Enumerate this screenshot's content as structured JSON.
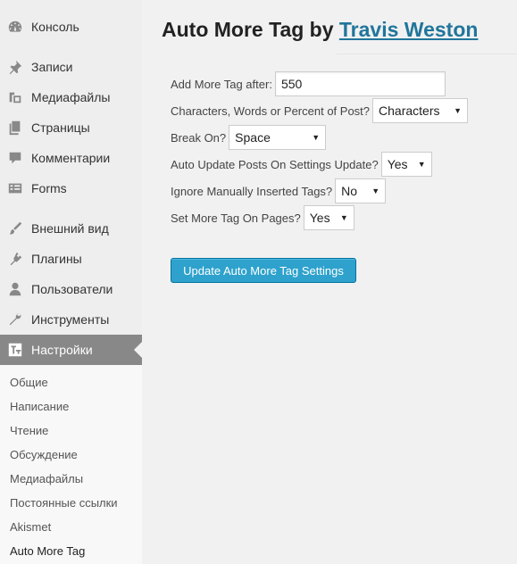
{
  "sidebar": {
    "items": [
      {
        "label": "Консоль",
        "icon": "dashboard-icon"
      },
      {
        "label": "Записи",
        "icon": "pin-icon"
      },
      {
        "label": "Медиафайлы",
        "icon": "media-icon"
      },
      {
        "label": "Страницы",
        "icon": "pages-icon"
      },
      {
        "label": "Комментарии",
        "icon": "comment-icon"
      },
      {
        "label": "Forms",
        "icon": "forms-icon"
      },
      {
        "label": "Внешний вид",
        "icon": "brush-icon"
      },
      {
        "label": "Плагины",
        "icon": "plugin-icon"
      },
      {
        "label": "Пользователи",
        "icon": "user-icon"
      },
      {
        "label": "Инструменты",
        "icon": "wrench-icon"
      },
      {
        "label": "Настройки",
        "icon": "settings-icon"
      }
    ],
    "submenu": [
      "Общие",
      "Написание",
      "Чтение",
      "Обсуждение",
      "Медиафайлы",
      "Постоянные ссылки",
      "Akismet",
      "Auto More Tag"
    ]
  },
  "main": {
    "title_prefix": "Auto More Tag by ",
    "title_link": "Travis Weston",
    "fields": {
      "add_after_label": "Add More Tag after:",
      "add_after_value": "550",
      "type_label": "Characters, Words or Percent of Post?",
      "type_value": "Characters",
      "break_label": "Break On?",
      "break_value": "Space",
      "auto_update_label": "Auto Update Posts On Settings Update?",
      "auto_update_value": "Yes",
      "ignore_label": "Ignore Manually Inserted Tags?",
      "ignore_value": "No",
      "pages_label": "Set More Tag On Pages?",
      "pages_value": "Yes"
    },
    "submit_label": "Update Auto More Tag Settings"
  },
  "colors": {
    "active_menu": "#888888",
    "button": "#2ea2cc",
    "link": "#21759b"
  }
}
